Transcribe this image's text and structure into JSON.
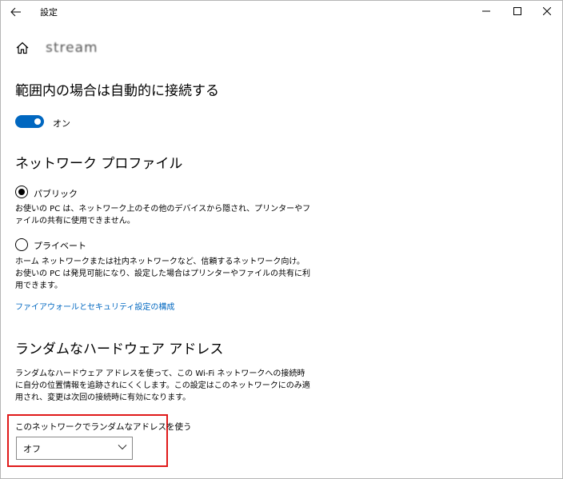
{
  "titlebar": {
    "title": "設定",
    "back_icon": "arrow-left-icon",
    "minimize_icon": "minimize-icon",
    "maximize_icon": "maximize-icon",
    "close_icon": "close-icon"
  },
  "header": {
    "home_icon": "home-icon",
    "network_name": "stream"
  },
  "auto_connect": {
    "title": "範囲内の場合は自動的に接続する",
    "toggle_state": "オン",
    "toggle_color": "#0067c0"
  },
  "network_profile": {
    "title": "ネットワーク プロファイル",
    "options": [
      {
        "label": "パブリック",
        "selected": true,
        "description": "お使いの PC は、ネットワーク上のその他のデバイスから隠され、プリンターやファイルの共有に使用できません。"
      },
      {
        "label": "プライベート",
        "selected": false,
        "description": "ホーム ネットワークまたは社内ネットワークなど、信頼するネットワーク向け。お使いの PC は発見可能になり、設定した場合はプリンターやファイルの共有に利用できます。"
      }
    ],
    "firewall_link": "ファイアウォールとセキュリティ設定の構成",
    "link_color": "#0067c0"
  },
  "random_hw": {
    "title": "ランダムなハードウェア アドレス",
    "description": "ランダムなハードウェア アドレスを使って、この Wi-Fi ネットワークへの接続時に自分の位置情報を追跡されにくくします。この設定はこのネットワークにのみ適用され、変更は次回の接続時に有効になります。",
    "dropdown_label": "このネットワークでランダムなアドレスを使う",
    "dropdown_value": "オフ",
    "highlight_color": "#e01a1a"
  }
}
